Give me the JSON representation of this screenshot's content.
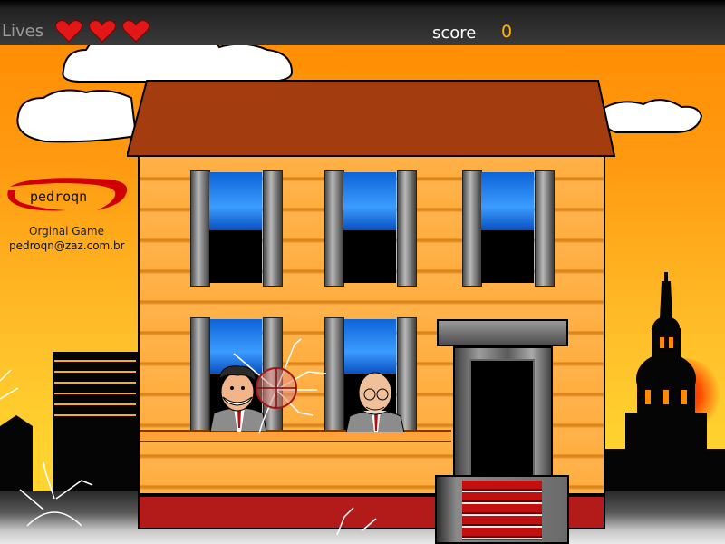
{
  "hud": {
    "lives_label": "Lives",
    "lives_count": 3,
    "score_label": "score",
    "score_value": "0"
  },
  "credits": {
    "logo_text": "pedroqn",
    "original_label": "Orginal Game",
    "email": "pedroqn@zaz.com.br"
  },
  "scene": {
    "windows_top_row": 3,
    "windows_bottom_row": 2,
    "characters": [
      "man-in-hat-window-left",
      "bald-man-window-right"
    ],
    "crosshair": "crosshair-icon"
  },
  "colors": {
    "sky_top": "#ff8a00",
    "sky_bottom": "#ffd633",
    "roof": "#a33d0f",
    "siding": "#ffb24a",
    "heart": "#e21818",
    "score": "#ffb600"
  }
}
